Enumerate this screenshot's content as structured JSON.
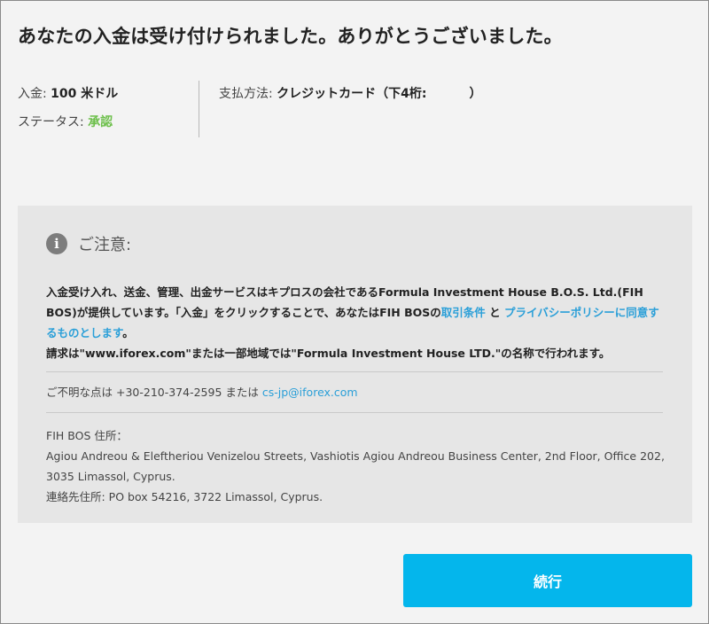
{
  "heading": "あなたの入金は受け付けられました。ありがとうございました。",
  "summary": {
    "deposit_label": "入金:",
    "deposit_value": "100 米ドル",
    "status_label": "ステータス:",
    "status_value": "承認",
    "payment_label": "支払方法:",
    "payment_value_prefix": "クレジットカード（下4桁:",
    "payment_value_suffix": "）"
  },
  "notice": {
    "title": "ご注意:",
    "body_1": "入金受け入れ、送金、管理、出金サービスはキプロスの会社であるFormula Investment House B.O.S. Ltd.(FIH BOS)が提供しています。「入金」をクリックすることで、あなたはFIH BOSの",
    "terms_link": "取引条件",
    "and": " と ",
    "privacy_link": "プライバシーポリシーに同意するものとします",
    "body_2": "。",
    "body_3": "請求は\"www.iforex.com\"または一部地域では\"Formula Investment House LTD.\"の名称で行われます。",
    "contact_prefix": "ご不明な点は +30-210-374-2595 または ",
    "contact_email": "cs-jp@iforex.com",
    "address_label": "FIH BOS 住所：",
    "address_line_1": "Agiou Andreou & Eleftheriou Venizelou Streets, Vashiotis Agiou Andreou Business Center, 2nd Floor, Office 202, 3035 Limassol, Cyprus.",
    "contact_address": "連絡先住所: PO box 54216, 3722 Limassol, Cyprus."
  },
  "button": {
    "continue_label": "続行"
  },
  "colors": {
    "accent": "#04b6ec",
    "status_green": "#6cbf4a",
    "link": "#2a9fd8"
  },
  "icons": {
    "notice_icon": "info-icon"
  }
}
